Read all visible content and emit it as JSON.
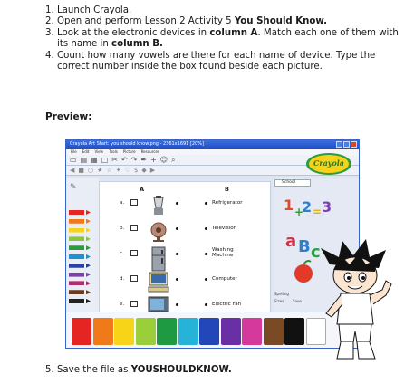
{
  "instructions": [
    {
      "num": "1.",
      "parts": [
        {
          "t": "Launch Crayola."
        }
      ]
    },
    {
      "num": "2.",
      "parts": [
        {
          "t": "Open and perform Lesson 2 Activity 5 "
        },
        {
          "t": "You Should Know.",
          "b": true
        }
      ]
    },
    {
      "num": "3.",
      "parts": [
        {
          "t": "Look at the electronic devices in "
        },
        {
          "t": "column A",
          "b": true
        },
        {
          "t": ". Match each one of them with its name in "
        },
        {
          "t": "column B.",
          "b": true
        }
      ]
    },
    {
      "num": "4.",
      "parts": [
        {
          "t": "Count how many vowels are there for each name of device. Type the correct number inside the box found beside each picture."
        }
      ]
    }
  ],
  "preview_label": "Preview:",
  "window": {
    "title": "Crayola Art Start: you should know.png - 2361x1691 [20%]",
    "menu": [
      "File",
      "Edit",
      "View",
      "Tools",
      "Picture",
      "Resources"
    ],
    "logo_text": "Crayola",
    "panel_dropdown": "School",
    "panel_buttons": [
      "Spelling",
      "Sizes",
      "Save"
    ]
  },
  "worksheet": {
    "col_a_header": "A",
    "col_b_header": "B",
    "row_letters": [
      "a.",
      "b.",
      "c.",
      "d.",
      "e."
    ],
    "column_b_names": [
      "Refrigerator",
      "Television",
      "Washing Machine",
      "Computer",
      "Electric Fan"
    ]
  },
  "colors": {
    "markers": [
      "#e52521",
      "#f07a1a",
      "#f7d417",
      "#8cc63f",
      "#2a9d3d",
      "#1f8fd6",
      "#2b3fa8",
      "#7d3fa8",
      "#b12d6e",
      "#6b3a1f",
      "#222222"
    ],
    "swatches": [
      "#e52521",
      "#f07a1a",
      "#f7d417",
      "#9bcf3a",
      "#1e9a43",
      "#26b3d8",
      "#2347b8",
      "#6b2fa5",
      "#d4399b",
      "#7a4a24",
      "#111111",
      "#ffffff"
    ]
  },
  "save_instruction": {
    "num": "5.",
    "parts": [
      {
        "t": "Save the file as "
      },
      {
        "t": "YOUSHOULDKNOW.",
        "b": true
      }
    ]
  }
}
